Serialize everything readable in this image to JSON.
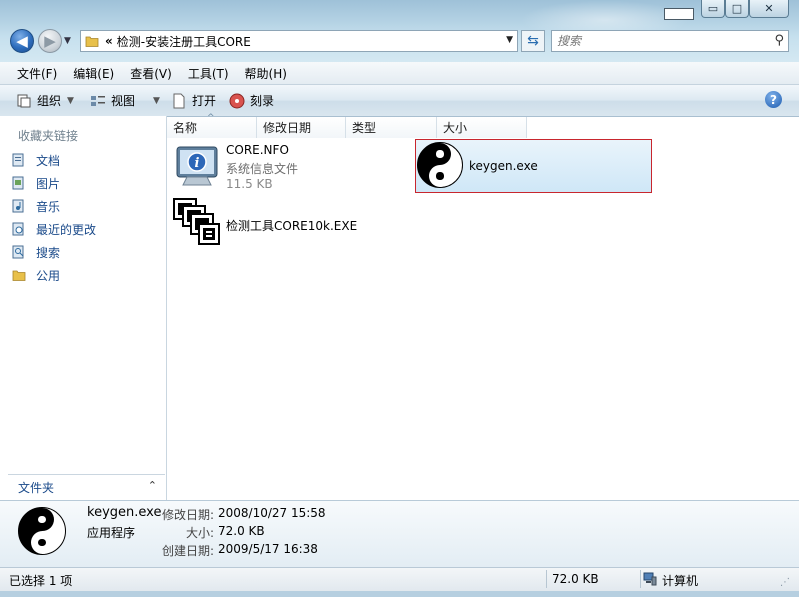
{
  "window": {
    "minimize_label": "▭",
    "maximize_label": "□",
    "close_label": "✕"
  },
  "nav": {
    "back_glyph": "◀",
    "forward_glyph": "▶",
    "address_prefix": "«",
    "address_path": "检测-安装注册工具CORE",
    "search_placeholder": "搜索"
  },
  "menu": {
    "items": [
      "文件(F)",
      "编辑(E)",
      "查看(V)",
      "工具(T)",
      "帮助(H)"
    ]
  },
  "toolbar": {
    "organize": "组织",
    "views": "视图",
    "open": "打开",
    "burn": "刻录",
    "help": "?"
  },
  "sidebar": {
    "title": "收藏夹链接",
    "items": [
      {
        "label": "文档",
        "icon": "documents-icon"
      },
      {
        "label": "图片",
        "icon": "pictures-icon"
      },
      {
        "label": "音乐",
        "icon": "music-icon"
      },
      {
        "label": "最近的更改",
        "icon": "recent-changes-icon"
      },
      {
        "label": "搜索",
        "icon": "search-folder-icon"
      },
      {
        "label": "公用",
        "icon": "public-folder-icon"
      }
    ],
    "folders_label": "文件夹",
    "folders_chevron": "⌃"
  },
  "columns": [
    "名称",
    "修改日期",
    "类型",
    "大小"
  ],
  "files": [
    {
      "name": "CORE.NFO",
      "type": "系统信息文件",
      "size": "11.5 KB",
      "icon": "system-info-file-icon"
    },
    {
      "name": "检测工具CORE10k.EXE",
      "icon": "executable-app-icon"
    },
    {
      "name": "keygen.exe",
      "icon": "yin-yang-icon",
      "selected": true
    }
  ],
  "details": {
    "name": "keygen.exe",
    "kind": "应用程序",
    "modified_label": "修改日期:",
    "modified_value": "2008/10/27 15:58",
    "size_label": "大小:",
    "size_value": "72.0 KB",
    "created_label": "创建日期:",
    "created_value": "2009/5/17 16:38"
  },
  "status": {
    "selection": "已选择 1 项",
    "size": "72.0 KB",
    "location": "计算机"
  },
  "colors": {
    "selection_border": "#c8262e",
    "link_blue": "#1a4a8a",
    "chrome_blue": "#b4d2e4"
  }
}
